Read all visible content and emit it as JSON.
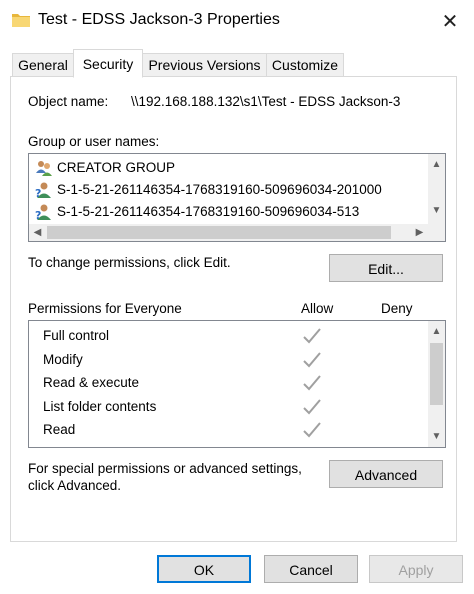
{
  "window": {
    "title": "Test - EDSS Jackson-3 Properties",
    "close_glyph": "✕"
  },
  "tabs": [
    {
      "label": "General"
    },
    {
      "label": "Security"
    },
    {
      "label": "Previous Versions"
    },
    {
      "label": "Customize"
    }
  ],
  "object": {
    "label": "Object name:",
    "value": "\\\\192.168.188.132\\s1\\Test - EDSS Jackson-3"
  },
  "groups": {
    "label": "Group or user names:",
    "items": [
      {
        "name": "CREATOR GROUP",
        "icon": "group-icon"
      },
      {
        "name": "S-1-5-21-261146354-1768319160-509696034-201000",
        "icon": "unknown-user-icon"
      },
      {
        "name": "S-1-5-21-261146354-1768319160-509696034-513",
        "icon": "unknown-user-icon"
      }
    ]
  },
  "change_text": "To change permissions, click Edit.",
  "edit_button": "Edit...",
  "permissions": {
    "label": "Permissions for Everyone",
    "allow_label": "Allow",
    "deny_label": "Deny",
    "items": [
      {
        "name": "Full control",
        "allow": true,
        "deny": false
      },
      {
        "name": "Modify",
        "allow": true,
        "deny": false
      },
      {
        "name": "Read & execute",
        "allow": true,
        "deny": false
      },
      {
        "name": "List folder contents",
        "allow": true,
        "deny": false
      },
      {
        "name": "Read",
        "allow": true,
        "deny": false
      }
    ]
  },
  "special": {
    "line1": "For special permissions or advanced settings,",
    "line2": "click Advanced."
  },
  "advanced_button": "Advanced",
  "footer": {
    "ok": "OK",
    "cancel": "Cancel",
    "apply": "Apply"
  },
  "colors": {
    "check": "#a0a0a0",
    "default_border": "#0078d7",
    "scrollbar_thumb": "#cdcdcd"
  }
}
